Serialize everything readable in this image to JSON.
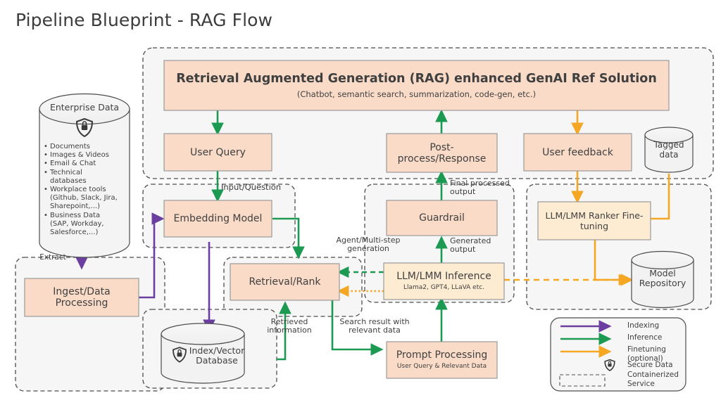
{
  "page": {
    "title": "Pipeline Blueprint - RAG Flow",
    "bg": "#ffffff"
  },
  "colors": {
    "box_fill": "#FADBC8",
    "box_stroke": "#9A9A9A",
    "ft_box_fill": "#FDEBD2",
    "container_fill": "#F6F6F6",
    "container_stroke": "#4D4D4D",
    "cylinder_fill": "#F2F2F2",
    "cylinder_stroke": "#4D4D4D",
    "indexing": "#6B3FA0",
    "inference": "#1D9A52",
    "finetuning": "#F5A623",
    "text": "#404040"
  },
  "datasource": {
    "name": "Enterprise Data",
    "icon": "shield-lock-icon",
    "bullets": [
      "Documents",
      "Images & Videos",
      "Email & Chat",
      "Technical\ndatabases",
      "Workplace tools\n(Github, Slack, Jira,\nSharepoint,...)",
      "Business Data\n(SAP, Workday,\nSalesforce,...)"
    ]
  },
  "nodes": {
    "rag_solution": {
      "title": "Retrieval Augmented Generation (RAG) enhanced GenAI Ref Solution",
      "subtitle": "(Chatbot, semantic search, summarization, code-gen, etc.)"
    },
    "user_query": {
      "title": "User Query"
    },
    "post_process": {
      "title": "Post-\nprocess/Response"
    },
    "user_feedback": {
      "title": "User feedback"
    },
    "tagged_data": {
      "title": "Tagged\ndata"
    },
    "embedding_model": {
      "title": "Embedding Model"
    },
    "guardrail": {
      "title": "Guardrail"
    },
    "ranker_finetune": {
      "title": "LLM/LMM Ranker Fine-\ntuning"
    },
    "ingest": {
      "title": "Ingest/Data\nProcessing"
    },
    "retrieval_rank": {
      "title": "Retrieval/Rank"
    },
    "llm_inference": {
      "title": "LLM/LMM Inference",
      "subtitle": "Llama2, GPT4, LLaVA etc."
    },
    "model_repository": {
      "title": "Model\nRepository"
    },
    "index_vector_db": {
      "title": "Index/Vector\nDatabase",
      "icon": "shield-lock-icon"
    },
    "prompt_processing": {
      "title": "Prompt Processing",
      "subtitle": "User Query & Relevant Data"
    }
  },
  "edge_labels": {
    "extract": "Extract",
    "input_question": "Input/Question",
    "final_processed_output": "Final processed\noutput",
    "agent_multistep": "Agent/Multi-step\ngeneration",
    "generated_output": "Generated\noutput",
    "retrieved_information": "Retrieved\ninformation",
    "search_result": "Search result with\nrelevant data"
  },
  "legend": {
    "items": [
      {
        "label": "Indexing",
        "kind": "arrow",
        "color": "#6B3FA0"
      },
      {
        "label": "Inference",
        "kind": "arrow",
        "color": "#1D9A52"
      },
      {
        "label": "Finetuning\n(optional)",
        "kind": "arrow",
        "color": "#F5A623"
      },
      {
        "label": "Secure Data",
        "kind": "shield-lock-icon",
        "color": "#4D4D4D"
      },
      {
        "label": "Containerized\nService",
        "kind": "dashed-box",
        "color": "#4D4D4D"
      }
    ]
  }
}
